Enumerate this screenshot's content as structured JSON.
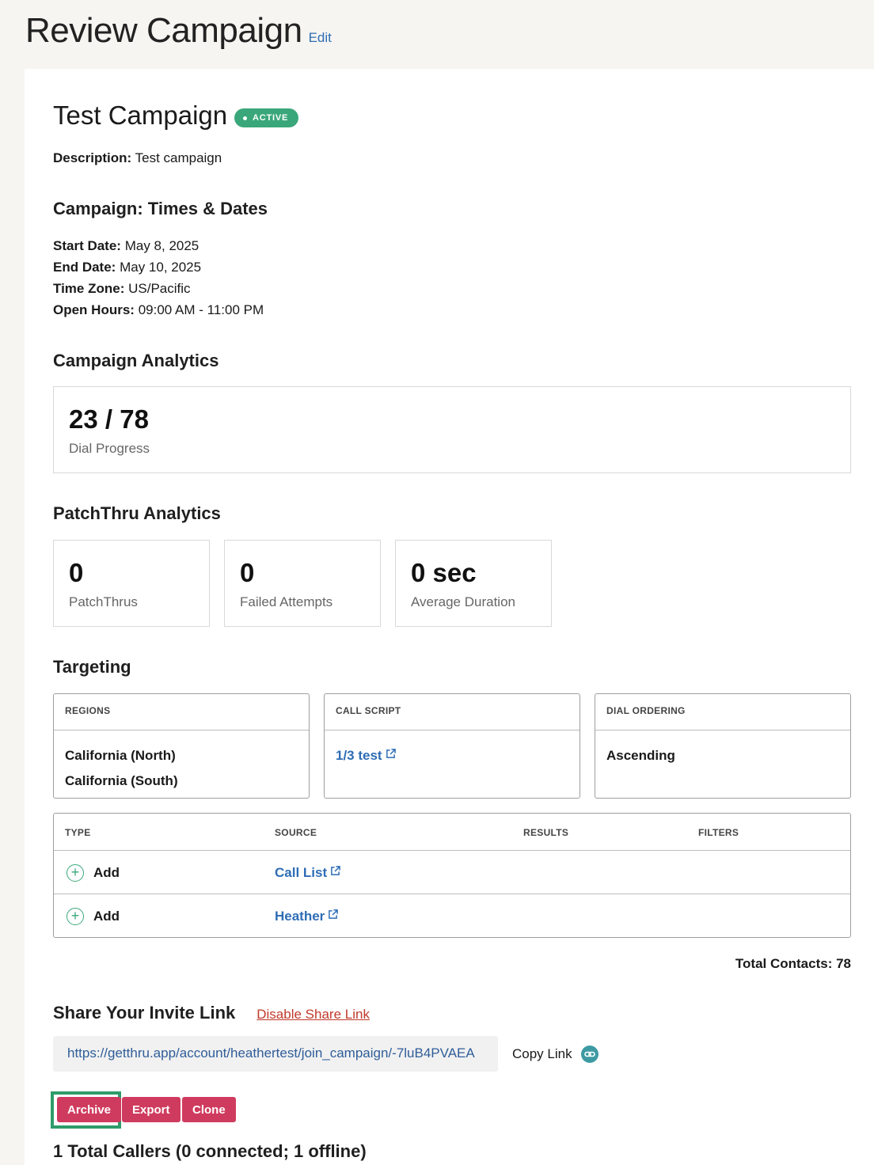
{
  "header": {
    "title": "Review Campaign",
    "edit_label": "Edit"
  },
  "campaign": {
    "name": "Test Campaign",
    "status": "ACTIVE",
    "description_label": "Description:",
    "description": "Test campaign"
  },
  "times": {
    "heading": "Campaign: Times & Dates",
    "start_label": "Start Date:",
    "start": "May 8, 2025",
    "end_label": "End Date:",
    "end": "May 10, 2025",
    "tz_label": "Time Zone:",
    "tz": "US/Pacific",
    "hours_label": "Open Hours:",
    "hours": "09:00 AM - 11:00 PM"
  },
  "analytics": {
    "heading": "Campaign Analytics",
    "progress_value": "23 / 78",
    "progress_label": "Dial Progress"
  },
  "patchthru": {
    "heading": "PatchThru Analytics",
    "stats": [
      {
        "value": "0",
        "label": "PatchThrus"
      },
      {
        "value": "0",
        "label": "Failed Attempts"
      },
      {
        "value": "0 sec",
        "label": "Average Duration"
      }
    ]
  },
  "targeting": {
    "heading": "Targeting",
    "regions_header": "REGIONS",
    "regions": [
      "California (North)",
      "California (South)"
    ],
    "script_header": "CALL SCRIPT",
    "script_link": "1/3 test",
    "ordering_header": "DIAL ORDERING",
    "ordering": "Ascending",
    "table_headers": {
      "type": "TYPE",
      "source": "SOURCE",
      "results": "RESULTS",
      "filters": "FILTERS"
    },
    "rows": [
      {
        "type": "Add",
        "source": "Call List"
      },
      {
        "type": "Add",
        "source": "Heather"
      }
    ],
    "total_contacts": "Total Contacts: 78"
  },
  "share": {
    "heading": "Share Your Invite Link",
    "disable_label": "Disable Share Link",
    "url": "https://getthru.app/account/heathertest/join_campaign/-7luB4PVAEA",
    "copy_label": "Copy Link"
  },
  "actions": {
    "archive": "Archive",
    "export": "Export",
    "clone": "Clone"
  },
  "callers": {
    "summary": "1 Total Callers (0 connected; 1 offline)"
  },
  "colors": {
    "accent_green": "#3aa77a",
    "danger": "#cf3b5e",
    "link": "#2f6db5"
  }
}
